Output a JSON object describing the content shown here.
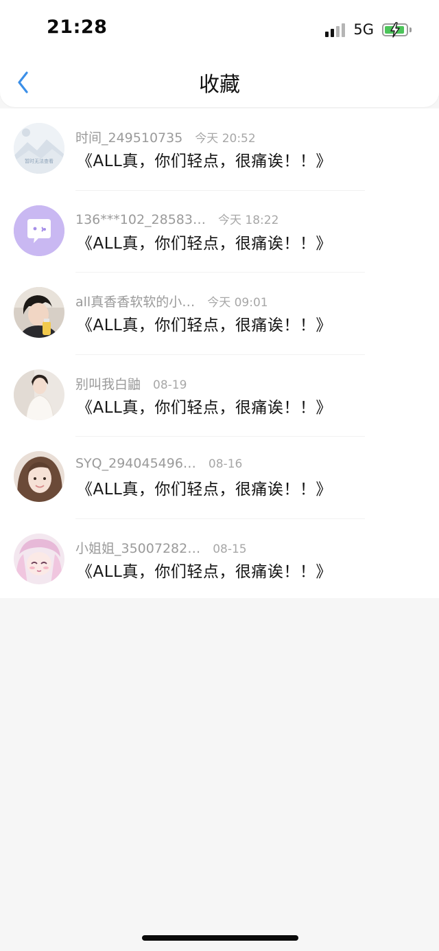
{
  "status_bar": {
    "time": "21:28",
    "network": "5G"
  },
  "nav": {
    "title": "收藏",
    "back_icon": "chevron-left-icon"
  },
  "favorites": [
    {
      "user": "时间_249510735",
      "time": "今天 20:52",
      "title": "《ALL真，你们轻点，很痛诶！！》",
      "avatar": "placeholder-mountain-avatar"
    },
    {
      "user": "136***102_28583…",
      "time": "今天 18:22",
      "title": "《ALL真，你们轻点，很痛诶！！》",
      "avatar": "chat-bubble-avatar"
    },
    {
      "user": "all真香香软软的小…",
      "time": "今天 09:01",
      "title": "《ALL真，你们轻点，很痛诶！！》",
      "avatar": "photo-avatar"
    },
    {
      "user": "别叫我白鼬",
      "time": "08-19",
      "title": "《ALL真，你们轻点，很痛诶！！》",
      "avatar": "photo-avatar"
    },
    {
      "user": "SYQ_294045496…",
      "time": "08-16",
      "title": "《ALL真，你们轻点，很痛诶！！》",
      "avatar": "photo-avatar"
    },
    {
      "user": "小姐姐_35007282…",
      "time": "08-15",
      "title": "《ALL真，你们轻点，很痛诶！！》",
      "avatar": "anime-avatar"
    }
  ],
  "placeholder_avatar_text": "暂时无法查看",
  "colors": {
    "accent": "#3b8fe8",
    "battery_green": "#4cc45a",
    "chat_avatar_bg": "#c9b8f2"
  }
}
